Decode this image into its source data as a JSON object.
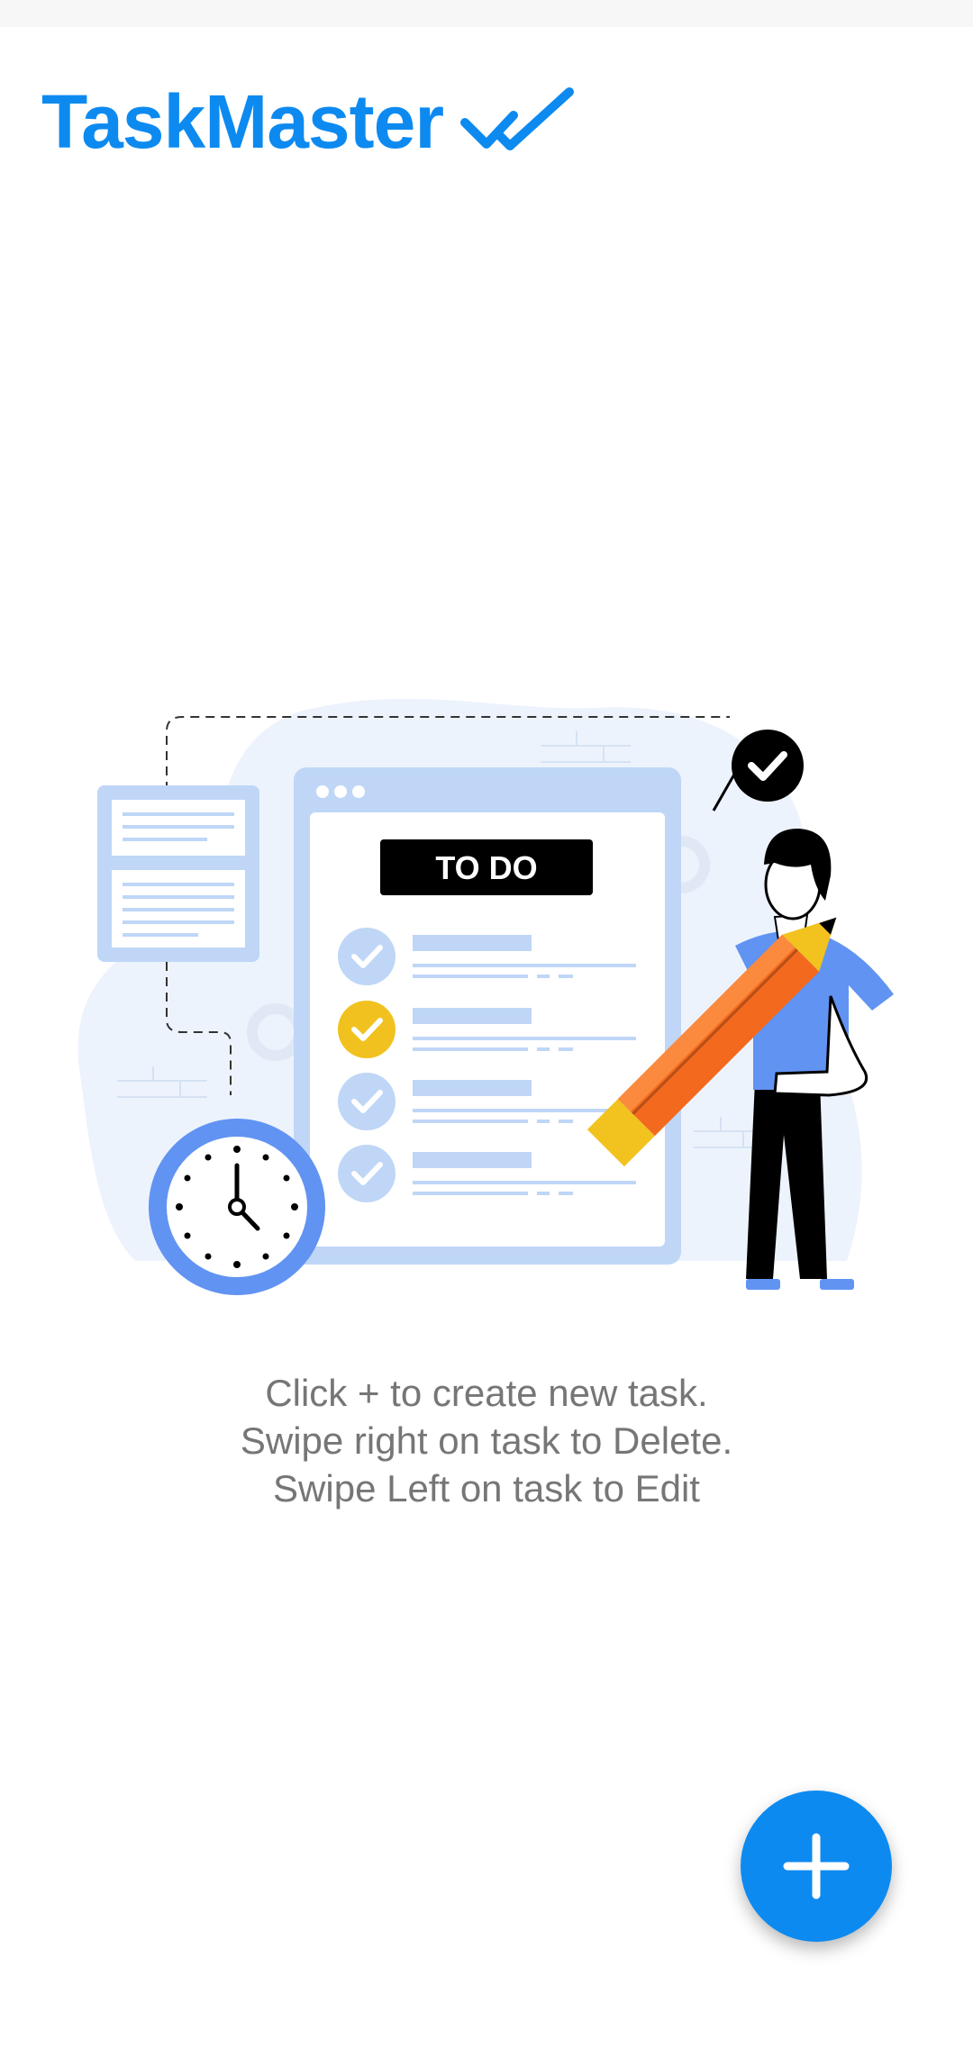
{
  "app": {
    "title": "TaskMaster",
    "title_icon": "double-check-icon",
    "accent_color": "#0d8af0"
  },
  "illustration": {
    "board_label": "TO DO",
    "icons": [
      "todo-board",
      "clock-icon",
      "pencil-icon",
      "check-badge-icon",
      "person"
    ]
  },
  "instructions": {
    "line1": "Click + to create new task.",
    "line2": "Swipe right on task to Delete.",
    "line3": "Swipe Left on task to Edit"
  },
  "fab": {
    "label": "+",
    "icon": "plus-icon"
  }
}
